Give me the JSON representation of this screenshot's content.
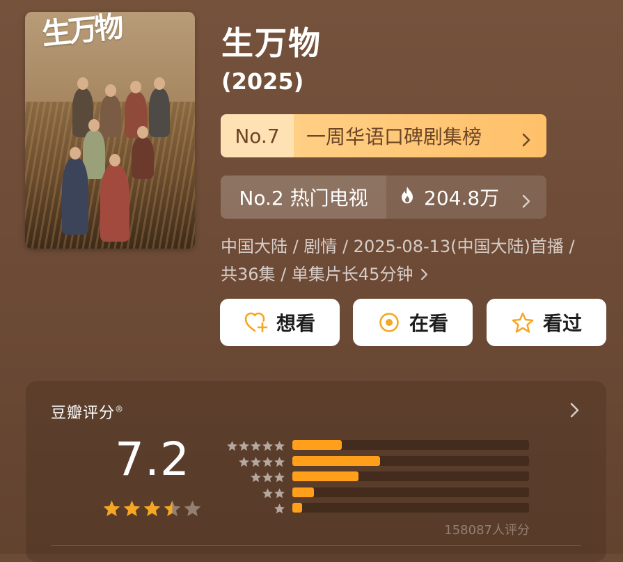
{
  "poster": {
    "calligraphy": "生万物"
  },
  "title": "生万物",
  "year": "(2025)",
  "rank_badge": {
    "number": "No.7",
    "label": "一周华语口碑剧集榜"
  },
  "hot_badge": {
    "number": "No.2 热门电视",
    "count": "204.8万"
  },
  "meta": {
    "line1": "中国大陆 / 剧情 / 2025-08-13(中国大陆)首播 /",
    "line2": "共36集 / 单集片长45分钟"
  },
  "actions": {
    "want": "想看",
    "watching": "在看",
    "watched": "看过"
  },
  "rating": {
    "header": "豆瓣评分",
    "header_mark": "®",
    "score": "7.2",
    "stars_value": 3.5,
    "distribution": [
      {
        "stars": 5,
        "fraction": 0.21
      },
      {
        "stars": 4,
        "fraction": 0.37
      },
      {
        "stars": 3,
        "fraction": 0.28
      },
      {
        "stars": 2,
        "fraction": 0.09
      },
      {
        "stars": 1,
        "fraction": 0.04
      }
    ],
    "count": "158087人评分"
  },
  "colors": {
    "background": "#6b4a36",
    "rank_gold": "#ffc06a",
    "accent_orange": "#ff9f1a",
    "icon_orange": "#f5a623"
  }
}
